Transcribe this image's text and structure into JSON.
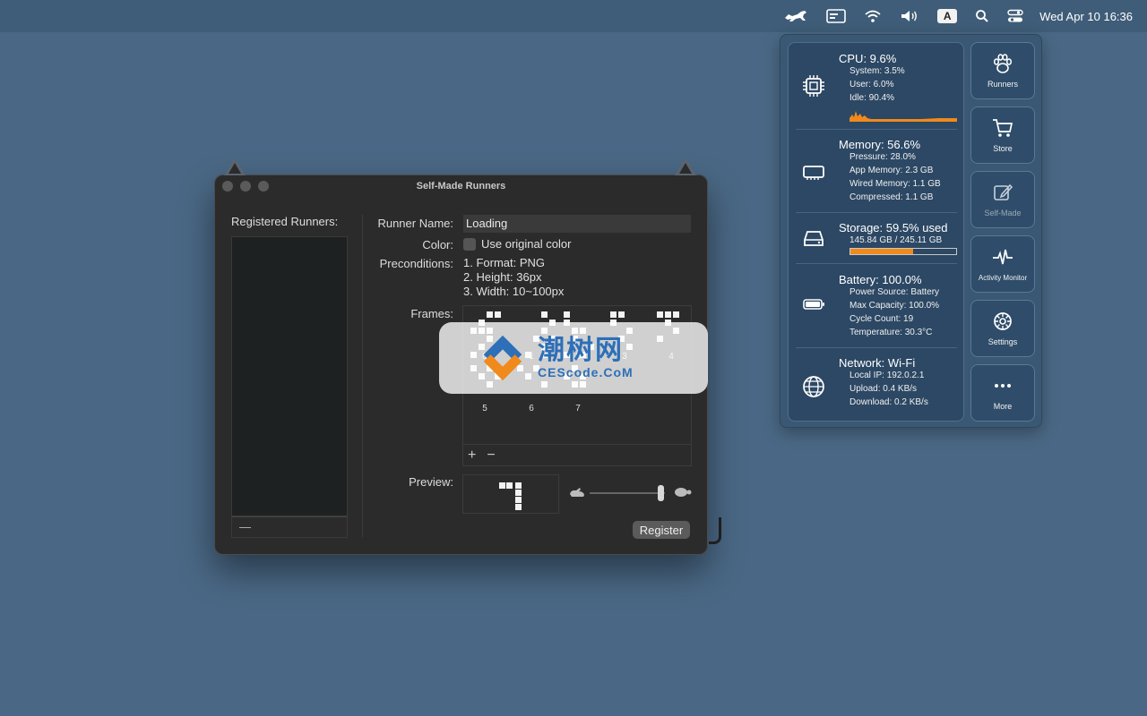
{
  "menubar": {
    "input_source": "A",
    "clock": "Wed Apr 10  16:36"
  },
  "window": {
    "title": "Self-Made Runners",
    "registered_label": "Registered Runners:",
    "list_minus": "—",
    "runner_name_label": "Runner Name:",
    "runner_name_value": "Loading",
    "color_label": "Color:",
    "use_original_color": "Use original color",
    "preconditions_label": "Preconditions:",
    "preconditions": [
      "1. Format: PNG",
      "2. Height: 36px",
      "3. Width: 10~100px"
    ],
    "frames_label": "Frames:",
    "frame_numbers": [
      "0",
      "1",
      "2",
      "3",
      "4",
      "5",
      "6",
      "7"
    ],
    "add_label": "+",
    "remove_label": "−",
    "preview_label": "Preview:",
    "register_label": "Register",
    "speed_slider_value": 0.95
  },
  "watermark": {
    "cn": "潮树网",
    "en": "CEScode.CoM"
  },
  "stats": {
    "cpu": {
      "title": "CPU:  9.6%",
      "lines": [
        "System:  3.5%",
        "User:  6.0%",
        "Idle:  90.4%"
      ]
    },
    "memory": {
      "title": "Memory: 56.6%",
      "lines": [
        "Pressure: 28.0%",
        "App Memory:  2.3 GB",
        "Wired Memory:  1.1 GB",
        "Compressed:  1.1 GB"
      ]
    },
    "storage": {
      "title": "Storage: 59.5% used",
      "detail": "145.84 GB / 245.11 GB",
      "used_fraction": 0.595
    },
    "battery": {
      "title": "Battery: 100.0%",
      "lines": [
        "Power Source: Battery",
        "Max Capacity: 100.0%",
        "Cycle Count: 19",
        "Temperature: 30.3°C"
      ]
    },
    "network": {
      "title": "Network: Wi-Fi",
      "lines": [
        "Local IP: 192.0.2.1",
        "Upload:   0.4 KB/s",
        "Download:   0.2 KB/s"
      ]
    }
  },
  "side_buttons": [
    {
      "label": "Runners",
      "icon": "paw-icon"
    },
    {
      "label": "Store",
      "icon": "cart-icon"
    },
    {
      "label": "Self-Made",
      "icon": "edit-icon"
    },
    {
      "label": "Activity Monitor",
      "icon": "pulse-icon"
    },
    {
      "label": "Settings",
      "icon": "gear-icon"
    },
    {
      "label": "More",
      "icon": "ellipsis-icon"
    }
  ],
  "colors": {
    "desktop": "#4a6885",
    "accent_orange": "#f08a1c",
    "window_bg": "#2b2b2b",
    "panel_bg": "#2c4864"
  }
}
